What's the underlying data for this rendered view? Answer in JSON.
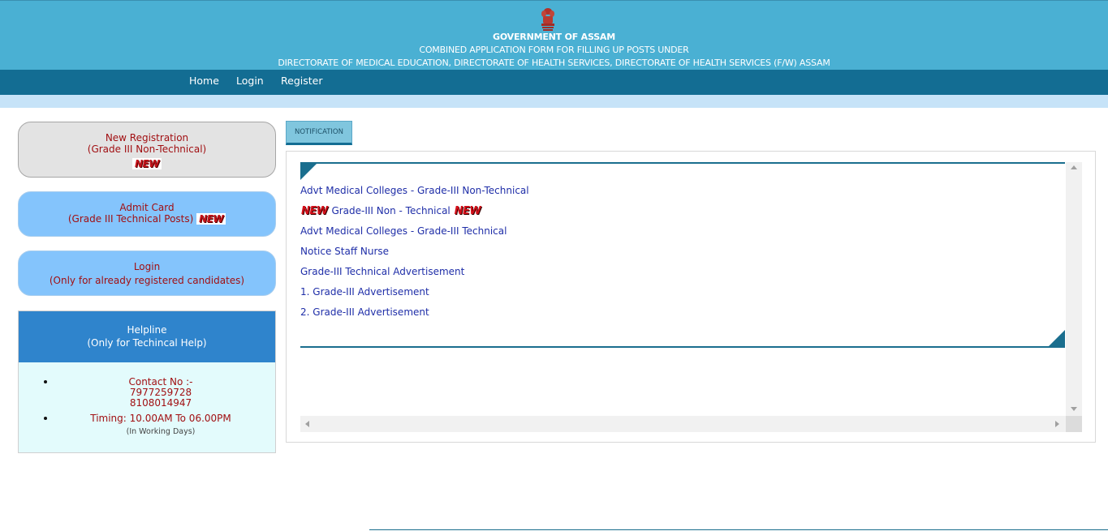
{
  "header": {
    "title": "GOVERNMENT OF ASSAM",
    "subtitle_line1": "COMBINED APPLICATION FORM FOR FILLING UP POSTS UNDER",
    "subtitle_line2": "DIRECTORATE OF MEDICAL EDUCATION, DIRECTORATE OF HEALTH SERVICES, DIRECTORATE OF HEALTH SERVICES (F/W) ASSAM"
  },
  "nav": {
    "home": "Home",
    "login": "Login",
    "register": "Register"
  },
  "sidebar": {
    "new_registration": {
      "line1": "New Registration",
      "line2": "(Grade III Non-Technical)",
      "badge": "NEW"
    },
    "admit_card": {
      "line1": "Admit Card",
      "line2": "(Grade III Technical Posts)",
      "badge": "NEW"
    },
    "login": {
      "line1": "Login",
      "line2": "(Only for already registered candidates)"
    },
    "helpline": {
      "title": "Helpline",
      "subtitle": "(Only for Techincal Help)",
      "contact_label": "Contact No :-",
      "phone1": "7977259728",
      "phone2": "8108014947",
      "timing": "Timing: 10.00AM To 06.00PM",
      "timing_note": "(In Working Days)"
    }
  },
  "notification": {
    "tab_label": "NOTIFICATION",
    "items": [
      {
        "text": "Advt Medical Colleges - Grade-III Non-Technical"
      },
      {
        "text": "Grade-III Non - Technical",
        "badge": "NEW"
      },
      {
        "text": "Advt Medical Colleges - Grade-III Technical"
      },
      {
        "text": "Notice Staff Nurse"
      },
      {
        "text": "Grade-III Technical Advertisement"
      },
      {
        "text": "1. Grade-III Advertisement"
      },
      {
        "text": "2. Grade-III Advertisement"
      }
    ]
  },
  "colors": {
    "header_bg": "#4ab0d3",
    "navbar_bg": "#136d93",
    "accent_red": "#a10f12",
    "link_blue": "#1f2ea8",
    "button_blue": "#84c4fc"
  },
  "icons": {
    "emblem": "state-emblem-icon",
    "scroll_up": "scroll-up-arrow-icon",
    "scroll_down": "scroll-down-arrow-icon",
    "scroll_left": "scroll-left-arrow-icon",
    "scroll_right": "scroll-right-arrow-icon"
  }
}
